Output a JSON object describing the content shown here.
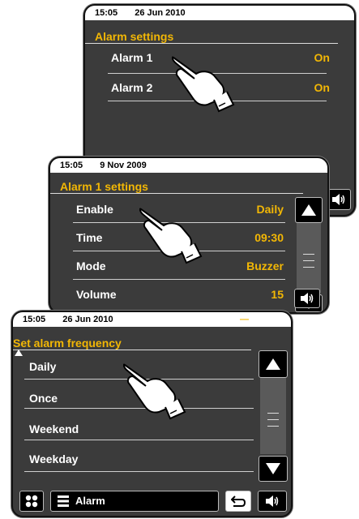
{
  "screen1": {
    "status": {
      "time": "15:05",
      "date": "26 Jun 2010"
    },
    "title": "Alarm settings",
    "items": [
      {
        "label": "Alarm 1",
        "value": "On"
      },
      {
        "label": "Alarm 2",
        "value": "On"
      }
    ]
  },
  "screen2": {
    "status": {
      "time": "15:05",
      "date": "9 Nov 2009"
    },
    "title": "Alarm 1 settings",
    "items": [
      {
        "label": "Enable",
        "value": "Daily"
      },
      {
        "label": "Time",
        "value": "09:30"
      },
      {
        "label": "Mode",
        "value": "Buzzer"
      },
      {
        "label": "Volume",
        "value": "15"
      }
    ]
  },
  "screen3": {
    "status": {
      "time": "15:05",
      "date": "26 Jun 2010",
      "indicator": "—"
    },
    "title": "Set alarm frequency",
    "items": [
      {
        "label": "Daily"
      },
      {
        "label": "Once"
      },
      {
        "label": "Weekend"
      },
      {
        "label": "Weekday"
      }
    ],
    "bottom_bar": {
      "menu_label": "Alarm"
    }
  },
  "icons": {
    "scroll_up": "triangle-up",
    "scroll_down": "triangle-down",
    "volume": "speaker",
    "back": "return-arrow",
    "menu": "list-lines",
    "home": "four-dots"
  },
  "colors": {
    "accent": "#f2b705",
    "screen_bg": "#3b3b3b",
    "text": "#ffffff"
  }
}
